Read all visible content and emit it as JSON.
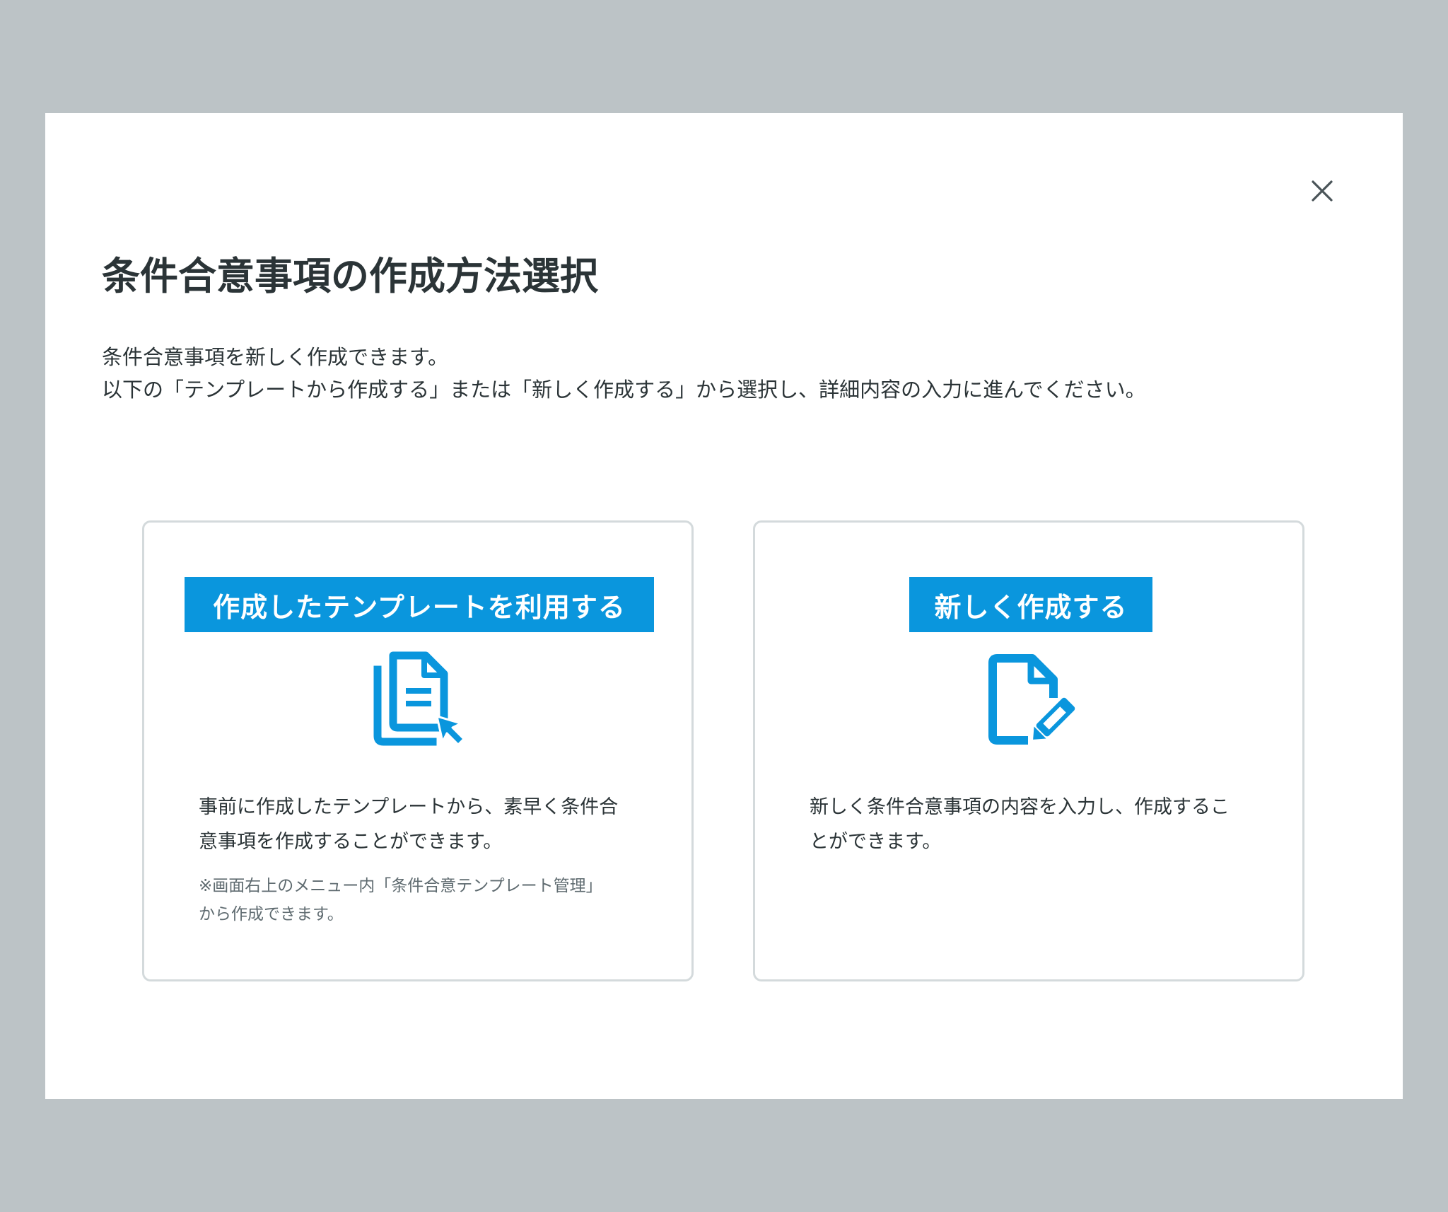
{
  "modal": {
    "title": "条件合意事項の作成方法選択",
    "description_lines": [
      "条件合意事項を新しく作成できます。",
      "以下の「テンプレートから作成する」または「新しく作成する」から選択し、詳細内容の入力に進んでください。"
    ],
    "close_icon": "close-icon"
  },
  "options": [
    {
      "label": "作成したテンプレートを利用する",
      "icon": "template-document-cursor-icon",
      "body_lines": [
        "事前に作成したテンプレートから、素早く条件合",
        "意事項を作成することができます。"
      ],
      "note_lines": [
        "※画面右上のメニュー内「条件合意テンプレート管理」",
        "から作成できます。"
      ]
    },
    {
      "label": "新しく作成する",
      "icon": "new-document-edit-icon",
      "body_lines": [
        "新しく条件合意事項の内容を入力し、作成するこ",
        "とができます。"
      ]
    }
  ],
  "colors": {
    "accent": "#0a96dd",
    "backdrop": "#bcc3c6",
    "text": "#2b3437",
    "muted_text": "#5f6b70",
    "card_border": "#d4dadc"
  }
}
